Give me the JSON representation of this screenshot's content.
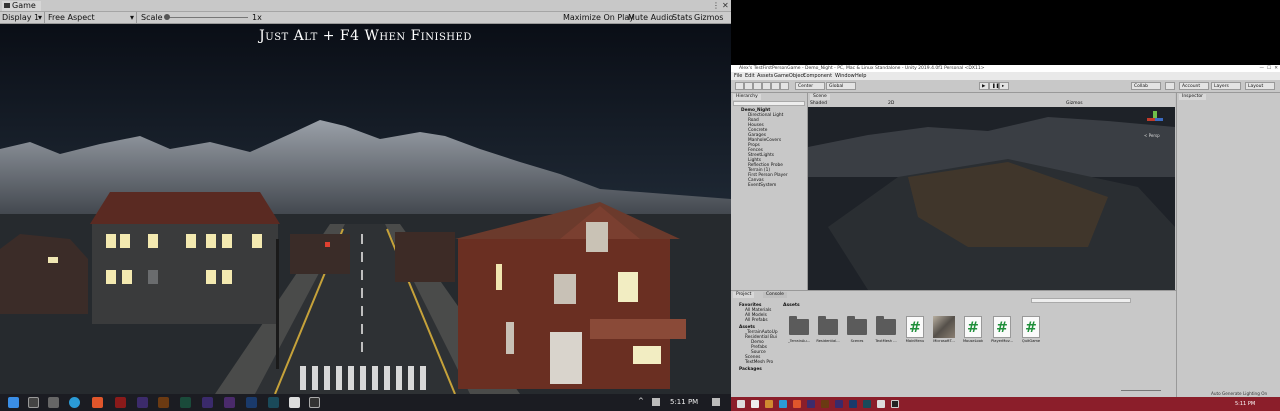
{
  "game_window": {
    "tab_title": "Game",
    "toolbar": {
      "display": "Display 1",
      "aspect": "Free Aspect",
      "scale_label": "Scale",
      "scale_value": "1x",
      "maximize_on_play": "Maximize On Play",
      "mute_audio": "Mute Audio",
      "stats": "Stats",
      "gizmos": "Gizmos"
    },
    "overlay_text": "Just Alt + F4 When Finished"
  },
  "taskbar_left": {
    "time": "5:11 PM",
    "icons": [
      "windows-icon",
      "search-icon",
      "task-view-icon",
      "edge-icon",
      "brave-icon",
      "app-icon",
      "after-effects-icon",
      "illustrator-icon",
      "animate-icon",
      "premiere-icon",
      "character-animator-icon",
      "photoshop-icon",
      "audition-icon",
      "unity-icon",
      "visual-studio-icon"
    ]
  },
  "editor": {
    "title_bar": "Alex's TestFirstPersonGame - Demo_Night - PC, Mac & Linux Standalone - Unity 2019.4.0f1 Personal <DX11>",
    "menu": [
      "File",
      "Edit",
      "Assets",
      "GameObject",
      "Component",
      "Window",
      "Help"
    ],
    "toolbar": {
      "center": "Center",
      "global": "Global",
      "collab": "Collab",
      "account": "Account",
      "layers": "Layers",
      "layout": "Layout"
    },
    "hierarchy": {
      "tab": "Hierarchy",
      "items": [
        "Demo_Night",
        "Directional Light",
        "Road",
        "Houses",
        "Concrete",
        "Garages",
        "ManholeCovers",
        "Props",
        "Fences",
        "StreetLights",
        "Lights",
        "Reflection Probe",
        "Terrain (1)",
        "First Person Player",
        "Canvas",
        "EventSystem"
      ]
    },
    "scene": {
      "tab": "Scene",
      "shading": "Shaded",
      "mode_2d": "2D",
      "gizmos": "Gizmos",
      "persp": "< Persp"
    },
    "inspector": {
      "tab": "Inspector"
    },
    "project": {
      "tabs": [
        "Project",
        "Console"
      ],
      "tree": [
        "Favorites",
        "All Materials",
        "All Models",
        "All Prefabs",
        "Assets",
        "_TerrainAutoUp",
        "Residential Bui",
        "Demo",
        "Prefabs",
        "Source",
        "Scenes",
        "TextMesh Pro",
        "Packages"
      ],
      "breadcrumb": "Assets",
      "assets": [
        {
          "kind": "folder",
          "label": "_TerrainAu..."
        },
        {
          "kind": "folder",
          "label": "Residential..."
        },
        {
          "kind": "folder",
          "label": "Scenes"
        },
        {
          "kind": "folder",
          "label": "TextMesh ..."
        },
        {
          "kind": "script",
          "label": "MainMenu"
        },
        {
          "kind": "image",
          "label": "MicrosoftT..."
        },
        {
          "kind": "script",
          "label": "MouseLook"
        },
        {
          "kind": "script",
          "label": "PlayerMov..."
        },
        {
          "kind": "script",
          "label": "QuitGame"
        }
      ]
    },
    "status": "Auto Generate Lighting On"
  },
  "taskbar_right": {
    "time": "5:11 PM"
  }
}
